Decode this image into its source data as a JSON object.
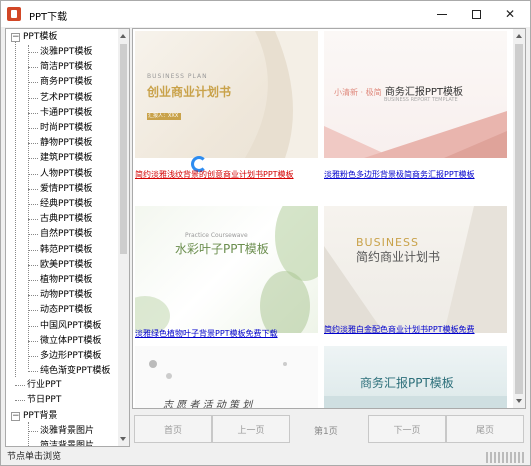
{
  "window": {
    "title": "PPT下载"
  },
  "tree": {
    "root1": "PPT模板",
    "children1": [
      "淡雅PPT模板",
      "简洁PPT模板",
      "商务PPT模板",
      "艺术PPT模板",
      "卡通PPT模板",
      "时尚PPT模板",
      "静物PPT模板",
      "建筑PPT模板",
      "人物PPT模板",
      "爱情PPT模板",
      "经典PPT模板",
      "古典PPT模板",
      "自然PPT模板",
      "韩范PPT模板",
      "欧美PPT模板",
      "植物PPT模板",
      "动物PPT模板",
      "动态PPT模板",
      "中国风PPT模板",
      "微立体PPT模板",
      "多边形PPT模板",
      "纯色渐变PPT模板"
    ],
    "root2": "行业PPT",
    "root3": "节日PPT",
    "root4": "PPT背景",
    "children4": [
      "淡雅背景图片",
      "简洁背景图片"
    ]
  },
  "cards": [
    {
      "link": "简约淡雅浅纹背景的创意商业计划书PPT模板",
      "title": "创业商业计划书",
      "subtitle": "BUSINESS PLAN",
      "tag": "汇报人：XXX",
      "link_color": "#d40000"
    },
    {
      "link": "淡雅粉色多边形背景极简商务汇报PPT模板",
      "title": "商务汇报PPT模板",
      "prefix": "小清新 · 极简",
      "subtitle": "BUSINESS REPORT TEMPLATE",
      "link_color": "#0000cc"
    },
    {
      "link": "淡雅绿色植物叶子背景PPT模板免费下载",
      "title": "水彩叶子PPT模板",
      "subtitle": "Practice Coursewave",
      "link_color": "#0000cc"
    },
    {
      "link": "简约淡雅白金配色商业计划书PPT模板免费",
      "title": "简约商业计划书",
      "subtitle": "BUSINESS",
      "link_color": "#0000cc"
    },
    {
      "title": "志 愿 者 活 动 策 划"
    },
    {
      "title": "商务汇报PPT模板"
    }
  ],
  "pager": {
    "first": "首页",
    "prev": "上一页",
    "page": "第1页",
    "next": "下一页",
    "last": "尾页"
  },
  "status": {
    "text": "节点单击浏览"
  },
  "colors": {
    "accent_gold": "#c9a24a",
    "link_blue": "#0000cc",
    "link_red": "#d40000"
  }
}
